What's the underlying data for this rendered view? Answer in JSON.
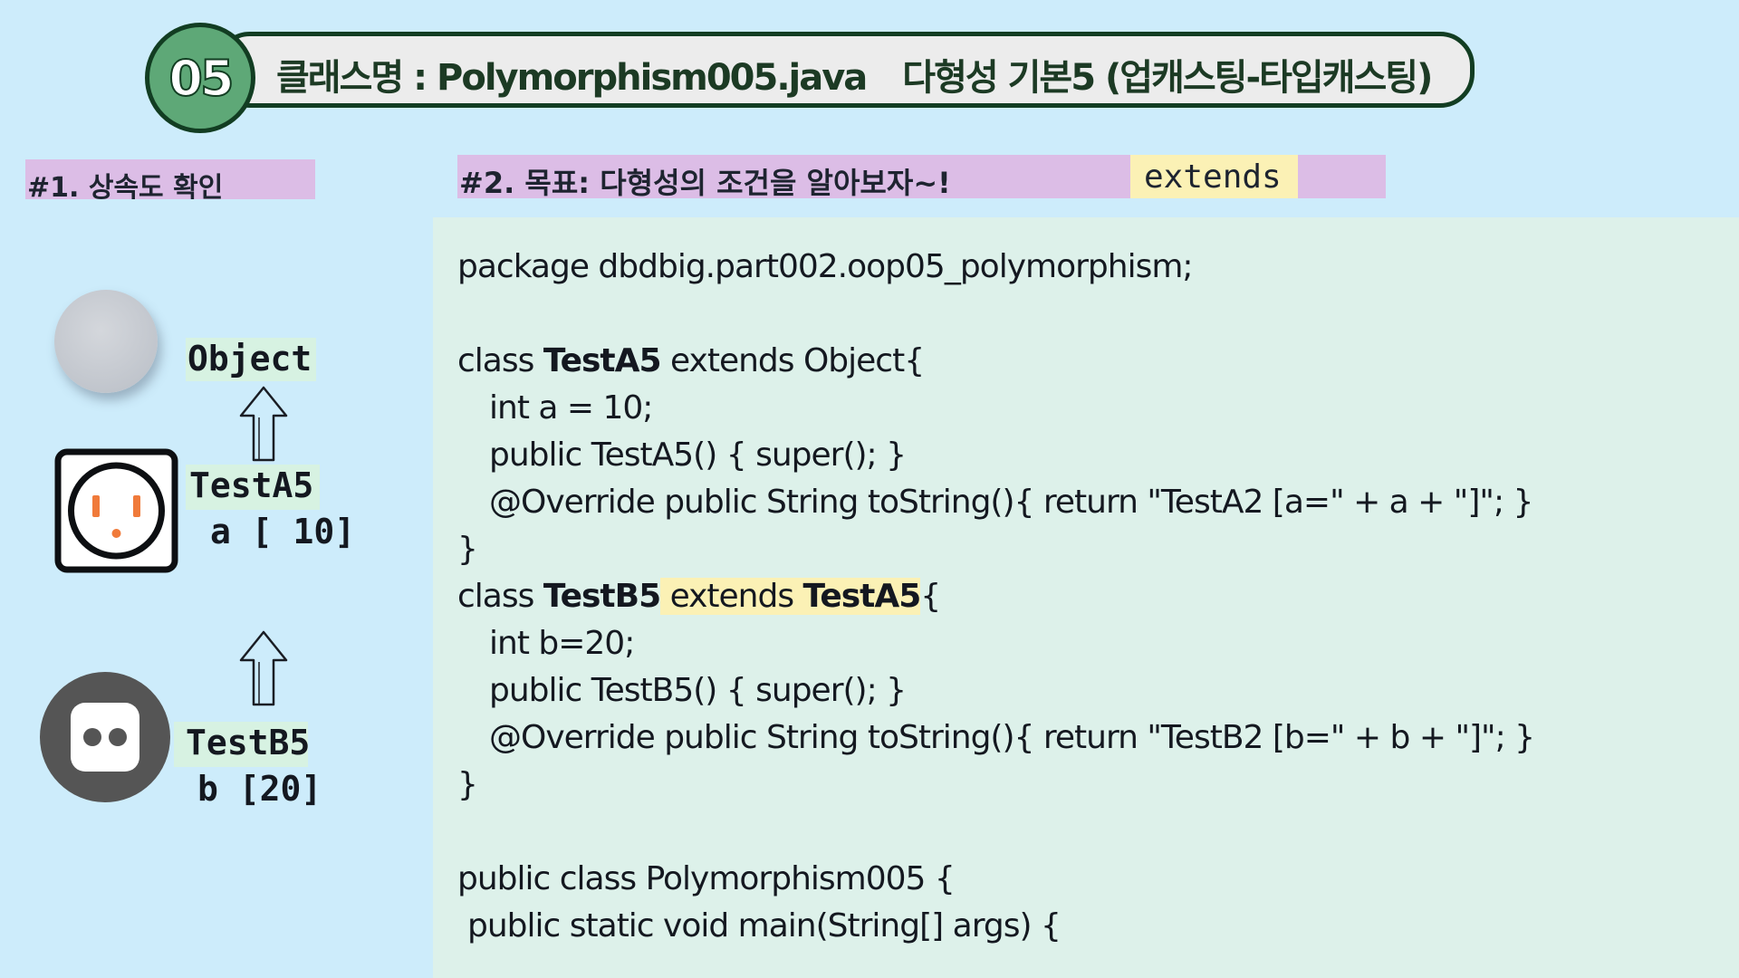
{
  "header": {
    "number": "05",
    "class_label": "클래스명 : Polymorphism005.java",
    "subtitle": "다형성 기본5 (업캐스팅-타입캐스팅)"
  },
  "section1": {
    "label": "#1. 상속도 확인"
  },
  "section2": {
    "label": "#2. 목표: 다형성의 조건을 알아보자~!",
    "tag": "extends"
  },
  "diagram": {
    "object_label": "Object",
    "a5_label": "TestA5",
    "a5_value": "a [ 10]",
    "b5_label": "TestB5",
    "b5_value": "b [20]",
    "colors": {
      "socket_a_accent": "#f07a3a",
      "socket_b_fill": "#555555"
    }
  },
  "code": {
    "line1": "package dbdbig.part002.oop05_polymorphism;",
    "line2_prefix": "class ",
    "line2_name": "TestA5",
    "line2_suffix": " extends Object{",
    "line3": "int a = 10;",
    "line4": "public TestA5() { super(); }",
    "line5": "@Override public String toString(){ return \"TestA2 [a=\" + a + \"]\"; }",
    "line6": "}",
    "line7_prefix": "class ",
    "line7_name": "TestB5",
    "line7_ext": " extends ",
    "line7_parent": "TestA5",
    "line7_suffix": "{",
    "line8": "int b=20;",
    "line9": "public TestB5() { super(); }",
    "line10": "@Override public String toString(){ return \"TestB2 [b=\" + b + \"]\"; }",
    "line11": "}",
    "line12": "public class Polymorphism005 {",
    "line13": "public static void main(String[] args) {"
  }
}
